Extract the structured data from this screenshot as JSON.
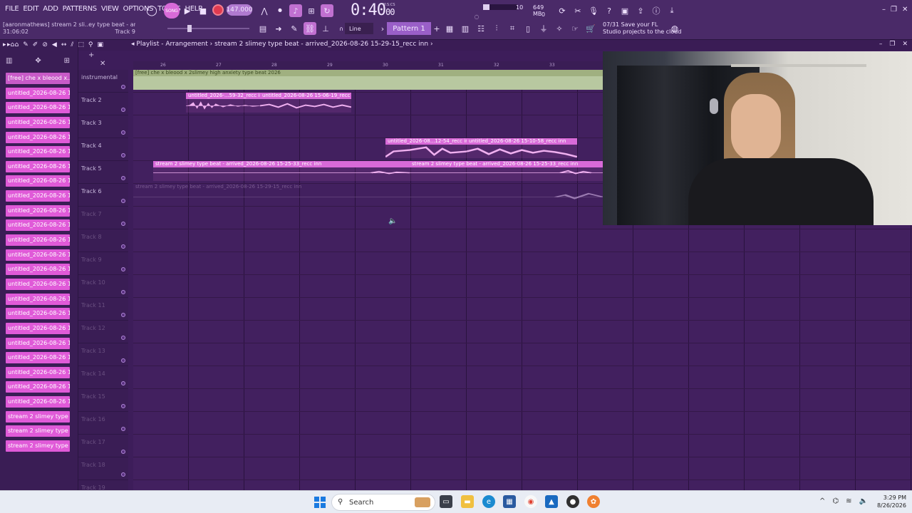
{
  "menu": [
    "FILE",
    "EDIT",
    "ADD",
    "PATTERNS",
    "VIEW",
    "OPTIONS",
    "TOOLS",
    "HELP"
  ],
  "hint": {
    "line1": "[aaronmathews] stream 2 sli..ey type beat - arrived.flp",
    "position": "31:06:02",
    "track": "Track 9"
  },
  "song_label": "SONG",
  "tempo": "147.000",
  "time": {
    "main": "0:40",
    "sub": "00",
    "unit": "M:S:CS"
  },
  "cpu": {
    "value": "10",
    "memory": "649 MB",
    "voices": "0"
  },
  "snap": "Line",
  "pattern": "Pattern 1",
  "cloud": {
    "count": "07/31",
    "line1": "Save your FL",
    "line2": "Studio projects to the cloud"
  },
  "browser": {
    "clips": [
      "[free] che x bleood x...",
      "untitled_2026-08-26 14-...",
      "untitled_2026-08-26 14-...",
      "untitled_2026-08-26 14-...",
      "untitled_2026-08-26 14-...",
      "untitled_2026-08-26 14-...",
      "untitled_2026-08-26 14-...",
      "untitled_2026-08-26 14-...",
      "untitled_2026-08-26 14-...",
      "untitled_2026-08-26 14-...",
      "untitled_2026-08-26 14-...",
      "untitled_2026-08-26 14-...",
      "untitled_2026-08-26 15-...",
      "untitled_2026-08-26 15-...",
      "untitled_2026-08-26 15-...",
      "untitled_2026-08-26 15-...",
      "untitled_2026-08-26 15-...",
      "untitled_2026-08-26 15-...",
      "untitled_2026-08-26 15-...",
      "untitled_2026-08-26 15-...",
      "untitled_2026-08-26 15-...",
      "untitled_2026-08-26 15-...",
      "untitled_2026-08-26 15-...",
      "stream 2 slimey type bea...",
      "stream 2 slimey type bea...",
      "stream 2 slimey type bea..."
    ]
  },
  "playlist": {
    "title_prefix": "Playlist - Arrangement",
    "title_file": "stream 2 slimey type beat - arrived_2026-08-26 15-29-15_recc inn",
    "ruler": [
      "26",
      "27",
      "28",
      "29",
      "30",
      "31",
      "32",
      "33"
    ],
    "tracks": [
      "instrumental",
      "Track 2",
      "Track 3",
      "Track 4",
      "Track 5",
      "Track 6",
      "Track 7",
      "Track 8",
      "Track 9",
      "Track 10",
      "Track 11",
      "Track 12",
      "Track 13",
      "Track 14",
      "Track 15",
      "Track 16",
      "Track 17",
      "Track 18",
      "Track 19"
    ],
    "clips": {
      "inst": "[free] che x bleood x 2slimey high anxiety type beat 2026",
      "t2a": "untitled_2026-...59-32_recc inn",
      "t2b": "untitled_2026-08-26 15-06-19_recc inn",
      "t4a": "untitled_2026-08...12-54_recc inn",
      "t4b": "untitled_2026-08-26 15-10-58_recc inn",
      "t5a": "stream 2 slimey type beat - arrived_2026-08-26 15-25-33_recc inn",
      "t5b": "stream 2 slimey type beat - arrived_2026-08-26 15-25-33_recc inn",
      "t6": "stream 2 slimey type beat - arrived_2026-08-26 15-29-15_recc inn"
    }
  },
  "taskbar": {
    "search": "Search",
    "time": "3:29 PM",
    "date": "8/26/2026"
  },
  "colors": {
    "clip": "#d86ad8",
    "bg": "#42205f",
    "accent": "#9a5fc8"
  }
}
